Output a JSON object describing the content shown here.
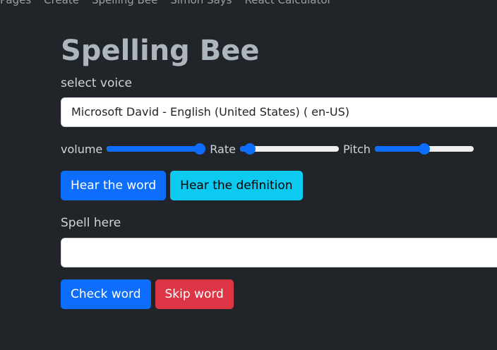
{
  "nav": {
    "items": [
      {
        "label": "Pages"
      },
      {
        "label": "Create"
      },
      {
        "label": "Spelling Bee"
      },
      {
        "label": "Simon Says"
      },
      {
        "label": "React Calculator"
      }
    ]
  },
  "page": {
    "title": "Spelling Bee"
  },
  "voice": {
    "label": "select voice",
    "selected": "Microsoft David - English (United States) ( en-US)"
  },
  "sliders": {
    "volume": {
      "label": "volume",
      "value": 1.0
    },
    "rate": {
      "label": "Rate",
      "value": 0.05
    },
    "pitch": {
      "label": "Pitch",
      "value": 0.5
    }
  },
  "actions": {
    "hear_word": "Hear the word",
    "hear_definition": "Hear the definition",
    "check_word": "Check word",
    "skip_word": "Skip word"
  },
  "spell": {
    "label": "Spell here",
    "value": ""
  },
  "colors": {
    "primary": "#0d6efd",
    "info": "#0dcaf0",
    "danger": "#dc3545",
    "background": "#212529"
  }
}
